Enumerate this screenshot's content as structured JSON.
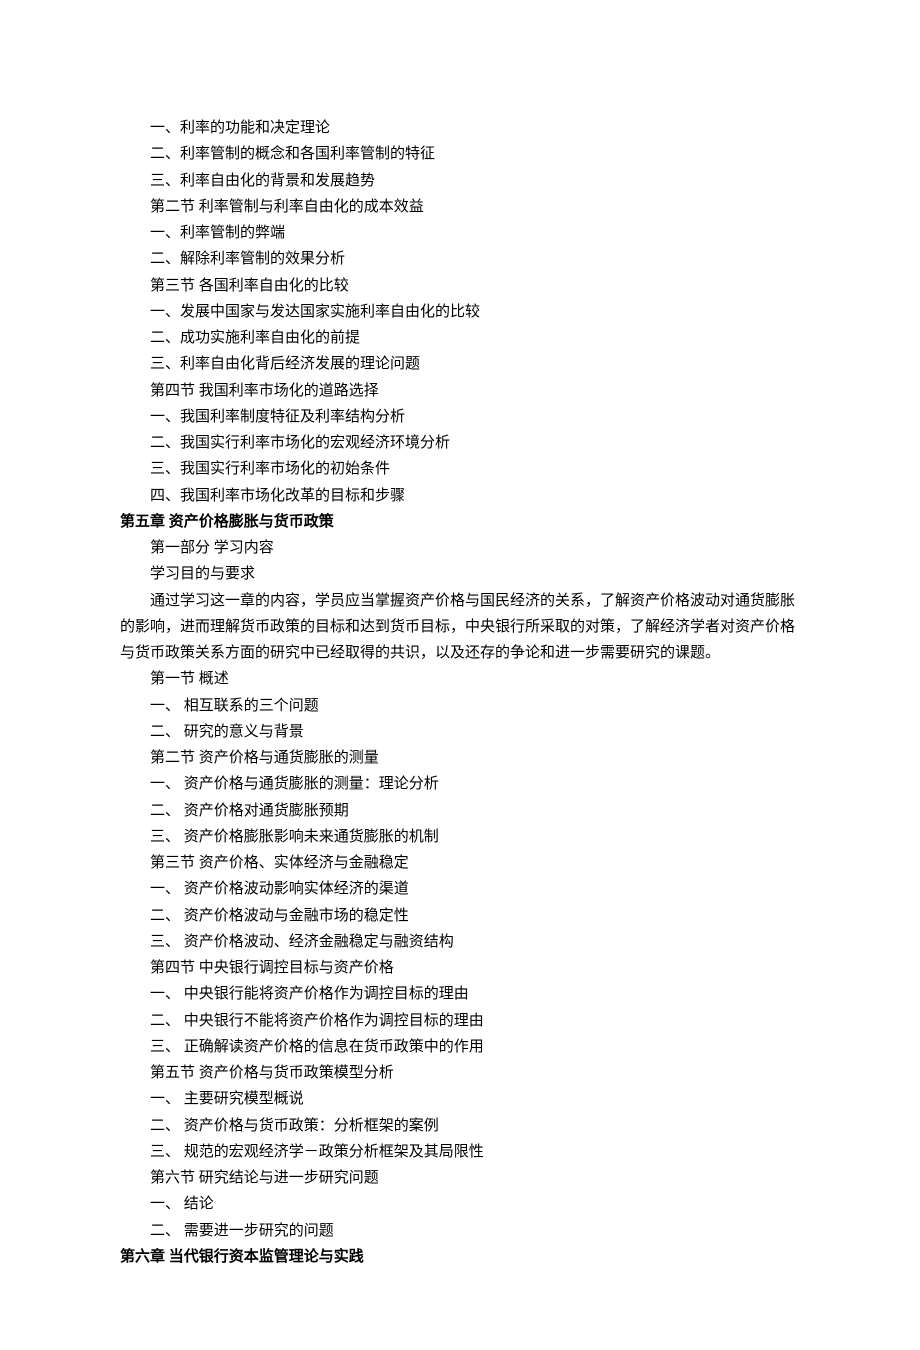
{
  "lines": [
    {
      "text": "一、利率的功能和决定理论",
      "cls": "indent-2"
    },
    {
      "text": "二、利率管制的概念和各国利率管制的特征",
      "cls": "indent-2"
    },
    {
      "text": "三、利率自由化的背景和发展趋势",
      "cls": "indent-2"
    },
    {
      "text": "第二节 利率管制与利率自由化的成本效益",
      "cls": "indent-2"
    },
    {
      "text": "一、利率管制的弊端",
      "cls": "indent-2"
    },
    {
      "text": "二、解除利率管制的效果分析",
      "cls": "indent-2"
    },
    {
      "text": "第三节 各国利率自由化的比较",
      "cls": "indent-2"
    },
    {
      "text": "一、发展中国家与发达国家实施利率自由化的比较",
      "cls": "indent-2"
    },
    {
      "text": "二、成功实施利率自由化的前提",
      "cls": "indent-2"
    },
    {
      "text": "三、利率自由化背后经济发展的理论问题",
      "cls": "indent-2"
    },
    {
      "text": "第四节 我国利率市场化的道路选择",
      "cls": "indent-2"
    },
    {
      "text": "一、我国利率制度特征及利率结构分析",
      "cls": "indent-2"
    },
    {
      "text": "二、我国实行利率市场化的宏观经济环境分析",
      "cls": "indent-2"
    },
    {
      "text": "三、我国实行利率市场化的初始条件",
      "cls": "indent-2"
    },
    {
      "text": "四、我国利率市场化改革的目标和步骤",
      "cls": "indent-2"
    },
    {
      "text": "第五章 资产价格膨胀与货币政策",
      "cls": "indent-0 bold"
    },
    {
      "text": "第一部分 学习内容",
      "cls": "indent-2"
    },
    {
      "text": "学习目的与要求",
      "cls": "indent-2"
    },
    {
      "text": "通过学习这一章的内容，学员应当掌握资产价格与国民经济的关系，了解资产价格波动对通货膨胀的影响，进而理解货币政策的目标和达到货币目标，中央银行所采取的对策，了解经济学者对资产价格与货币政策关系方面的研究中已经取得的共识，以及还存的争论和进一步需要研究的课题。",
      "cls": "para-indent"
    },
    {
      "text": "第一节 概述",
      "cls": "indent-2"
    },
    {
      "text": "一、 相互联系的三个问题",
      "cls": "indent-2"
    },
    {
      "text": "二、 研究的意义与背景",
      "cls": "indent-2"
    },
    {
      "text": "第二节 资产价格与通货膨胀的测量",
      "cls": "indent-2"
    },
    {
      "text": "一、 资产价格与通货膨胀的测量：理论分析",
      "cls": "indent-2"
    },
    {
      "text": "二、 资产价格对通货膨胀预期",
      "cls": "indent-2"
    },
    {
      "text": "三、 资产价格膨胀影响未来通货膨胀的机制",
      "cls": "indent-2"
    },
    {
      "text": "第三节 资产价格、实体经济与金融稳定",
      "cls": "indent-2"
    },
    {
      "text": "一、 资产价格波动影响实体经济的渠道",
      "cls": "indent-2"
    },
    {
      "text": "二、 资产价格波动与金融市场的稳定性",
      "cls": "indent-2"
    },
    {
      "text": "三、 资产价格波动、经济金融稳定与融资结构",
      "cls": "indent-2"
    },
    {
      "text": "第四节 中央银行调控目标与资产价格",
      "cls": "indent-2"
    },
    {
      "text": "一、 中央银行能将资产价格作为调控目标的理由",
      "cls": "indent-2"
    },
    {
      "text": "二、 中央银行不能将资产价格作为调控目标的理由",
      "cls": "indent-2"
    },
    {
      "text": "三、 正确解读资产价格的信息在货币政策中的作用",
      "cls": "indent-2"
    },
    {
      "text": "第五节 资产价格与货币政策模型分析",
      "cls": "indent-2"
    },
    {
      "text": "一、 主要研究模型概说",
      "cls": "indent-2"
    },
    {
      "text": "二、 资产价格与货币政策：分析框架的案例",
      "cls": "indent-2"
    },
    {
      "text": "三、 规范的宏观经济学－政策分析框架及其局限性",
      "cls": "indent-2"
    },
    {
      "text": "第六节  研究结论与进一步研究问题",
      "cls": "indent-2"
    },
    {
      "text": "一、 结论",
      "cls": "indent-2"
    },
    {
      "text": "二、 需要进一步研究的问题",
      "cls": "indent-2"
    },
    {
      "text": "第六章 当代银行资本监管理论与实践",
      "cls": "indent-0 bold"
    }
  ]
}
